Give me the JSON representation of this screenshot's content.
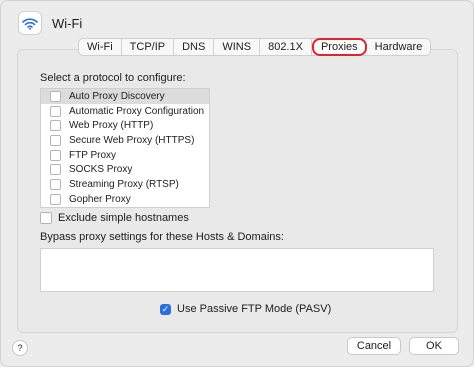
{
  "window": {
    "title": "Wi-Fi"
  },
  "tabs": [
    {
      "label": "Wi-Fi",
      "selected": false
    },
    {
      "label": "TCP/IP",
      "selected": false
    },
    {
      "label": "DNS",
      "selected": false
    },
    {
      "label": "WINS",
      "selected": false
    },
    {
      "label": "802.1X",
      "selected": false
    },
    {
      "label": "Proxies",
      "selected": true
    },
    {
      "label": "Hardware",
      "selected": false
    }
  ],
  "proxies": {
    "prompt": "Select a protocol to configure:",
    "protocols": [
      {
        "label": "Auto Proxy Discovery",
        "checked": false,
        "selected": true
      },
      {
        "label": "Automatic Proxy Configuration",
        "checked": false,
        "selected": false
      },
      {
        "label": "Web Proxy (HTTP)",
        "checked": false,
        "selected": false
      },
      {
        "label": "Secure Web Proxy (HTTPS)",
        "checked": false,
        "selected": false
      },
      {
        "label": "FTP Proxy",
        "checked": false,
        "selected": false
      },
      {
        "label": "SOCKS Proxy",
        "checked": false,
        "selected": false
      },
      {
        "label": "Streaming Proxy (RTSP)",
        "checked": false,
        "selected": false
      },
      {
        "label": "Gopher Proxy",
        "checked": false,
        "selected": false
      }
    ],
    "exclude_simple_hostnames": {
      "label": "Exclude simple hostnames",
      "checked": false
    },
    "bypass_label": "Bypass proxy settings for these Hosts & Domains:",
    "bypass_value": "",
    "passive_ftp": {
      "label": "Use Passive FTP Mode (PASV)",
      "checked": true
    }
  },
  "footer": {
    "help": "?",
    "cancel": "Cancel",
    "ok": "OK"
  },
  "colors": {
    "accent": "#2c6de0",
    "highlight_ring": "#e0232b"
  },
  "icons": {
    "window": "wifi-icon",
    "check": "checkmark-icon"
  }
}
